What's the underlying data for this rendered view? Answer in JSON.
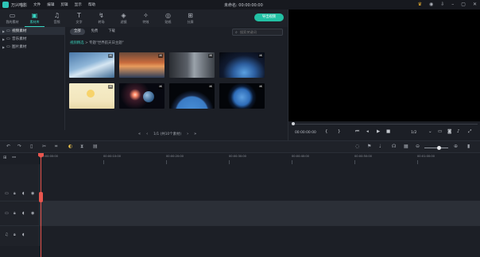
{
  "app": {
    "name": "万兴喵影",
    "doc_title": "未命名:  00:00:00:00"
  },
  "menu": [
    "文件",
    "编辑",
    "剪辑",
    "显示",
    "帮助"
  ],
  "window_icons": [
    "crown-icon",
    "account-icon",
    "download-icon",
    "minimize-icon",
    "maximize-icon",
    "close-icon"
  ],
  "media_tabs": [
    {
      "label": "我的素材",
      "icon": "folder-icon",
      "glyph": "▭"
    },
    {
      "label": "素材库",
      "icon": "library-icon",
      "glyph": "▣"
    },
    {
      "label": "音频",
      "icon": "music-icon",
      "glyph": "♫"
    },
    {
      "label": "文字",
      "icon": "text-icon",
      "glyph": "T"
    },
    {
      "label": "转场",
      "icon": "transition-icon",
      "glyph": "↯"
    },
    {
      "label": "滤镜",
      "icon": "filter-icon",
      "glyph": "◈"
    },
    {
      "label": "特效",
      "icon": "effects-icon",
      "glyph": "✧"
    },
    {
      "label": "贴纸",
      "icon": "sticker-icon",
      "glyph": "◎"
    },
    {
      "label": "分屏",
      "icon": "split-screen-icon",
      "glyph": "⊞"
    }
  ],
  "active_media_tab": 1,
  "export_button": "导出视频",
  "accent_color": "#22c1a4",
  "tree": [
    {
      "label": "视频素材",
      "active": true
    },
    {
      "label": "音乐素材",
      "active": false
    },
    {
      "label": "图片素材",
      "active": false
    }
  ],
  "subtabs": [
    "全部",
    "免费",
    "下载"
  ],
  "active_subtab": 0,
  "search": {
    "placeholder": "搜索关键词"
  },
  "breadcrumb": {
    "link": "视频精选",
    "separator": ">",
    "current": "专题\"世界航天日主题\""
  },
  "thumbnails": [
    {
      "badge": "4K"
    },
    {
      "badge": "4K"
    },
    {
      "badge": "4K"
    },
    {
      "badge": "4K"
    },
    {
      "badge": "4K"
    },
    {
      "badge": "4K"
    },
    {
      "badge": "4K"
    },
    {
      "badge": "4K"
    }
  ],
  "pager": {
    "text": "1/1 (共10个素材)"
  },
  "preview": {
    "time": "00:00:00:00",
    "ratio": "1/2"
  },
  "ruler_labels": [
    "00:00:00:00",
    "00:00:10:00",
    "00:00:20:00",
    "00:00:30:00",
    "00:00:40:00",
    "00:00:50:00",
    "00:01:00:00"
  ],
  "playhead_color": "#e8554e"
}
